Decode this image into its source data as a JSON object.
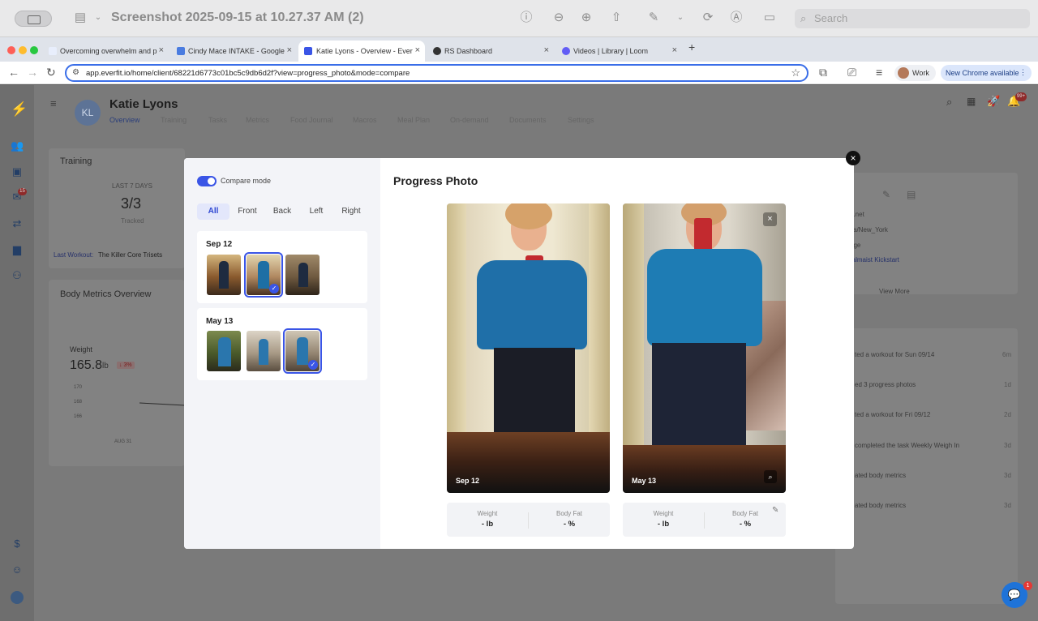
{
  "preview": {
    "title": "Screenshot 2025-09-15 at 10.27.37 AM (2)",
    "search_placeholder": "Search"
  },
  "browser": {
    "tabs": [
      {
        "label": "Overcoming overwhelm and p"
      },
      {
        "label": "Cindy Mace INTAKE - Google"
      },
      {
        "label": "Katie Lyons - Overview - Ever"
      },
      {
        "label": "RS Dashboard"
      },
      {
        "label": "Videos | Library | Loom"
      }
    ],
    "url": "app.everfit.io/home/client/68221d6773c01bc5c9db6d2f?view=progress_photo&mode=compare",
    "profile": "Work",
    "update_label": "New Chrome available"
  },
  "client": {
    "initials": "KL",
    "name": "Katie Lyons",
    "tabs": [
      "Overview",
      "Training",
      "Tasks",
      "Metrics",
      "Food Journal",
      "Macros",
      "Meal Plan",
      "On-demand",
      "Documents",
      "Settings"
    ]
  },
  "background": {
    "training_title": "Training",
    "last_days": "LAST 7 DAYS",
    "training_count": "3/3",
    "training_sub": "Tracked",
    "last_workout_label": "Last Workout:",
    "last_workout_value": "The Killer Core Trisets",
    "body_metrics_title": "Body Metrics Overview",
    "weight_label": "Weight",
    "weight_value": "165.8",
    "weight_unit": "lb",
    "weight_change": "↓ 3%",
    "y_ticks": [
      "170",
      "168",
      "166"
    ],
    "x_tick": "AUG 31",
    "rail_badge": "15",
    "notif_badge": "99+",
    "info_lines": [
      "e.net",
      "ca/New_York",
      "age",
      "ralmaist Kickstart"
    ],
    "view_more": "View More",
    "activity": [
      {
        "text": "ted a workout for Sun 09/14",
        "time": "6m"
      },
      {
        "text": "ed 3 progress photos",
        "time": "1d"
      },
      {
        "text": "ted a workout for Fri 09/12",
        "time": "2d"
      },
      {
        "text": "completed the task Weekly Weigh In",
        "time": "3d"
      },
      {
        "text": "ated body metrics",
        "time": "3d"
      },
      {
        "text": "ated body metrics",
        "time": "3d"
      }
    ]
  },
  "modal": {
    "compare_label": "Compare mode",
    "filters": [
      "All",
      "Front",
      "Back",
      "Left",
      "Right"
    ],
    "groups": [
      {
        "date": "Sep 12"
      },
      {
        "date": "May 13"
      }
    ],
    "title": "Progress Photo",
    "photos": [
      {
        "date": "Sep 12",
        "weight_label": "Weight",
        "weight_value": "- lb",
        "bodyfat_label": "Body Fat",
        "bodyfat_value": "- %"
      },
      {
        "date": "May 13",
        "weight_label": "Weight",
        "weight_value": "- lb",
        "bodyfat_label": "Body Fat",
        "bodyfat_value": "- %"
      }
    ]
  },
  "chat": {
    "badge": "1"
  },
  "colors": {
    "accent": "#3a55e6",
    "omnibox_border": "#3a6ee8",
    "chat": "#1f73d8"
  }
}
